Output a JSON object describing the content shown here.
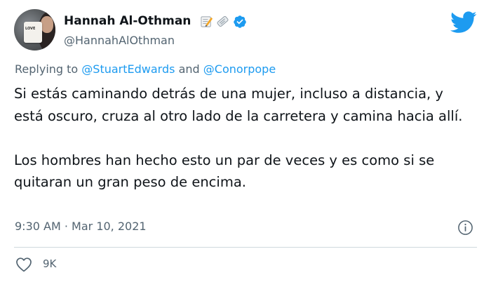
{
  "author": {
    "display_name": "Hannah Al-Othman",
    "handle": "@HannahAlOthman",
    "avatar_text": "LOVE"
  },
  "reply": {
    "prefix": "Replying to",
    "mention_1": "@StuartEdwards",
    "joiner": "and",
    "mention_2": "@Conorpope"
  },
  "tweet": {
    "paragraph_1": "Si estás caminando detrás de una mujer, incluso a distancia, y está oscuro, cruza al otro lado de la carretera y camina hacia allí.",
    "paragraph_2": "Los hombres han hecho esto un par de veces y es como si se quitaran un gran peso de encima."
  },
  "meta": {
    "time": "9:30 AM",
    "separator": "·",
    "date": "Mar 10, 2021"
  },
  "stats": {
    "likes": "9K"
  },
  "icons": {
    "badges": [
      "memo-emoji",
      "newspaper-emoji",
      "verified-icon"
    ],
    "brand": "twitter-bird-icon",
    "info": "info-icon",
    "like": "heart-icon"
  },
  "colors": {
    "brand_blue": "#1d9bf0",
    "text_primary": "#0f1419",
    "text_secondary": "#536471",
    "divider": "#cfd9de"
  }
}
